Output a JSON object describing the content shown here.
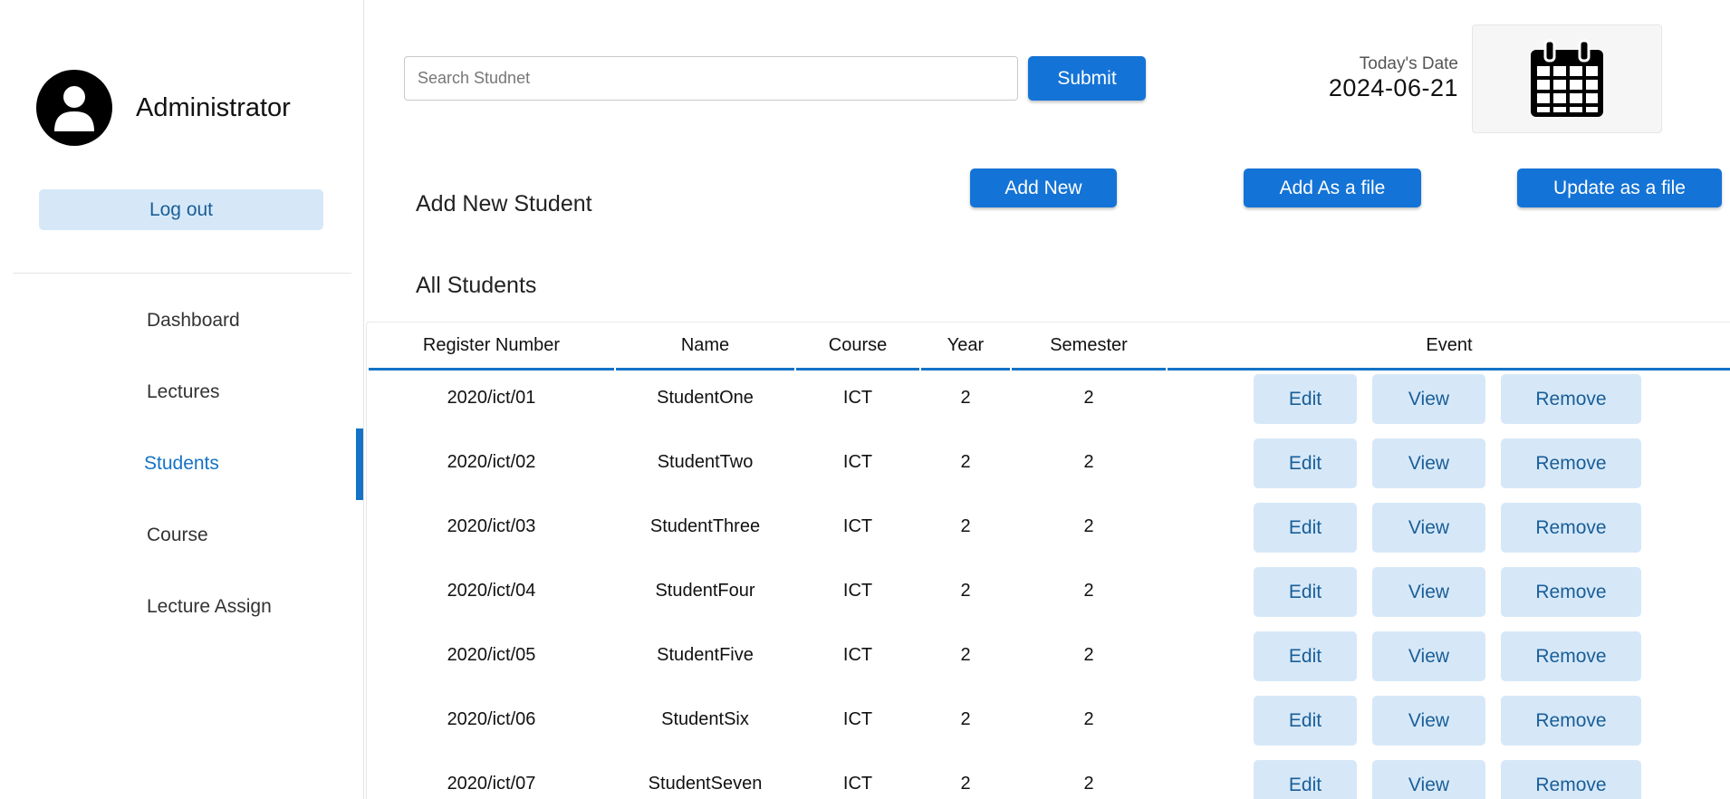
{
  "sidebar": {
    "user_name": "Administrator",
    "logout_label": "Log out",
    "nav": [
      {
        "label": "Dashboard"
      },
      {
        "label": "Lectures"
      },
      {
        "label": "Students"
      },
      {
        "label": "Course"
      },
      {
        "label": "Lecture Assign"
      }
    ],
    "active_item": "Students"
  },
  "header": {
    "search_placeholder": "Search Studnet",
    "search_value": "",
    "submit_label": "Submit",
    "date_label": "Today's Date",
    "date_value": "2024-06-21"
  },
  "actions": {
    "add_student_title": "Add New Student",
    "add_new_label": "Add New",
    "add_file_label": "Add As a file",
    "update_file_label": "Update as a file"
  },
  "students": {
    "title": "All Students",
    "columns": [
      "Register Number",
      "Name",
      "Course",
      "Year",
      "Semester",
      "Event"
    ],
    "rows": [
      {
        "reg": "2020/ict/01",
        "name": "StudentOne",
        "course": "ICT",
        "year": "2",
        "semester": "2"
      },
      {
        "reg": "2020/ict/02",
        "name": "StudentTwo",
        "course": "ICT",
        "year": "2",
        "semester": "2"
      },
      {
        "reg": "2020/ict/03",
        "name": "StudentThree",
        "course": "ICT",
        "year": "2",
        "semester": "2"
      },
      {
        "reg": "2020/ict/04",
        "name": "StudentFour",
        "course": "ICT",
        "year": "2",
        "semester": "2"
      },
      {
        "reg": "2020/ict/05",
        "name": "StudentFive",
        "course": "ICT",
        "year": "2",
        "semester": "2"
      },
      {
        "reg": "2020/ict/06",
        "name": "StudentSix",
        "course": "ICT",
        "year": "2",
        "semester": "2"
      },
      {
        "reg": "2020/ict/07",
        "name": "StudentSeven",
        "course": "ICT",
        "year": "2",
        "semester": "2"
      }
    ],
    "row_actions": {
      "edit": "Edit",
      "view": "View",
      "remove": "Remove"
    }
  },
  "colors": {
    "accent": "#1473d6",
    "light_button": "#d6e8f8",
    "light_button_text": "#1a5e97"
  },
  "icons": {
    "avatar": "user-avatar-icon",
    "calendar": "calendar-icon"
  }
}
